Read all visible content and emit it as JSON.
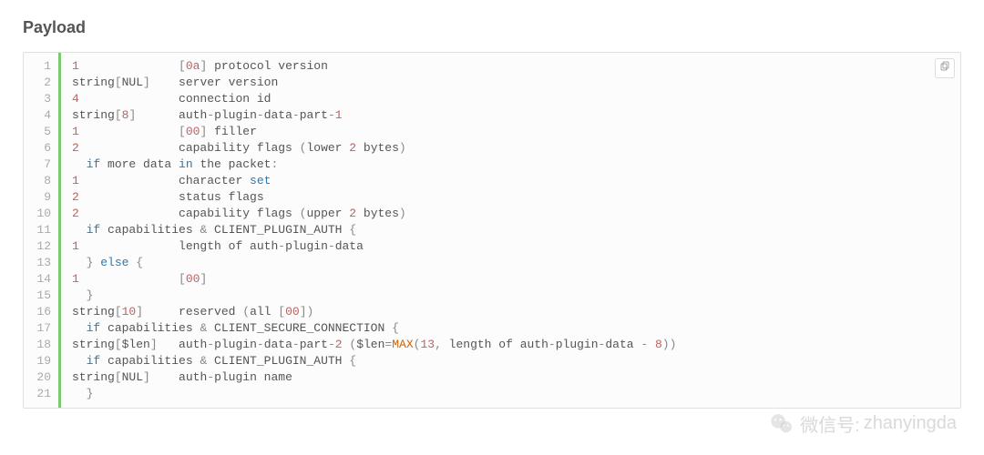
{
  "heading": "Payload",
  "watermark": {
    "label": "微信号:",
    "id": "zhanyingda"
  },
  "code": {
    "line_count": 21,
    "lines": [
      {
        "tokens": [
          {
            "t": "1",
            "c": "n"
          },
          {
            "t": "              ",
            "c": ""
          },
          {
            "t": "[",
            "c": "p"
          },
          {
            "t": "0a",
            "c": "n"
          },
          {
            "t": "]",
            "c": "p"
          },
          {
            "t": " protocol version",
            "c": ""
          }
        ]
      },
      {
        "tokens": [
          {
            "t": "string",
            "c": ""
          },
          {
            "t": "[",
            "c": "p"
          },
          {
            "t": "NUL",
            "c": ""
          },
          {
            "t": "]",
            "c": "p"
          },
          {
            "t": "    server version",
            "c": ""
          }
        ]
      },
      {
        "tokens": [
          {
            "t": "4",
            "c": "n"
          },
          {
            "t": "              connection id",
            "c": ""
          }
        ]
      },
      {
        "tokens": [
          {
            "t": "string",
            "c": ""
          },
          {
            "t": "[",
            "c": "p"
          },
          {
            "t": "8",
            "c": "n"
          },
          {
            "t": "]",
            "c": "p"
          },
          {
            "t": "      auth",
            "c": ""
          },
          {
            "t": "-",
            "c": "o"
          },
          {
            "t": "plugin",
            "c": ""
          },
          {
            "t": "-",
            "c": "o"
          },
          {
            "t": "data",
            "c": ""
          },
          {
            "t": "-",
            "c": "o"
          },
          {
            "t": "part",
            "c": ""
          },
          {
            "t": "-",
            "c": "o"
          },
          {
            "t": "1",
            "c": "n"
          }
        ]
      },
      {
        "tokens": [
          {
            "t": "1",
            "c": "n"
          },
          {
            "t": "              ",
            "c": ""
          },
          {
            "t": "[",
            "c": "p"
          },
          {
            "t": "00",
            "c": "n"
          },
          {
            "t": "]",
            "c": "p"
          },
          {
            "t": " filler",
            "c": ""
          }
        ]
      },
      {
        "tokens": [
          {
            "t": "2",
            "c": "n"
          },
          {
            "t": "              capability flags ",
            "c": ""
          },
          {
            "t": "(",
            "c": "p"
          },
          {
            "t": "lower ",
            "c": ""
          },
          {
            "t": "2",
            "c": "n"
          },
          {
            "t": " bytes",
            "c": ""
          },
          {
            "t": ")",
            "c": "p"
          }
        ]
      },
      {
        "tokens": [
          {
            "t": "  ",
            "c": ""
          },
          {
            "t": "if",
            "c": "kw"
          },
          {
            "t": " more data ",
            "c": ""
          },
          {
            "t": "in",
            "c": "kw"
          },
          {
            "t": " the packet",
            "c": ""
          },
          {
            "t": ":",
            "c": "p"
          }
        ]
      },
      {
        "tokens": [
          {
            "t": "1",
            "c": "n"
          },
          {
            "t": "              character ",
            "c": ""
          },
          {
            "t": "set",
            "c": "kw"
          }
        ]
      },
      {
        "tokens": [
          {
            "t": "2",
            "c": "n"
          },
          {
            "t": "              status flags",
            "c": ""
          }
        ]
      },
      {
        "tokens": [
          {
            "t": "2",
            "c": "n"
          },
          {
            "t": "              capability flags ",
            "c": ""
          },
          {
            "t": "(",
            "c": "p"
          },
          {
            "t": "upper ",
            "c": ""
          },
          {
            "t": "2",
            "c": "n"
          },
          {
            "t": " bytes",
            "c": ""
          },
          {
            "t": ")",
            "c": "p"
          }
        ]
      },
      {
        "tokens": [
          {
            "t": "  ",
            "c": ""
          },
          {
            "t": "if",
            "c": "kw"
          },
          {
            "t": " capabilities ",
            "c": ""
          },
          {
            "t": "&",
            "c": "o"
          },
          {
            "t": " CLIENT_PLUGIN_AUTH ",
            "c": ""
          },
          {
            "t": "{",
            "c": "p"
          }
        ]
      },
      {
        "tokens": [
          {
            "t": "1",
            "c": "n"
          },
          {
            "t": "              length of auth",
            "c": ""
          },
          {
            "t": "-",
            "c": "o"
          },
          {
            "t": "plugin",
            "c": ""
          },
          {
            "t": "-",
            "c": "o"
          },
          {
            "t": "data",
            "c": ""
          }
        ]
      },
      {
        "tokens": [
          {
            "t": "  ",
            "c": ""
          },
          {
            "t": "}",
            "c": "p"
          },
          {
            "t": " ",
            "c": ""
          },
          {
            "t": "else",
            "c": "kw"
          },
          {
            "t": " ",
            "c": ""
          },
          {
            "t": "{",
            "c": "p"
          }
        ]
      },
      {
        "tokens": [
          {
            "t": "1",
            "c": "n"
          },
          {
            "t": "              ",
            "c": ""
          },
          {
            "t": "[",
            "c": "p"
          },
          {
            "t": "00",
            "c": "n"
          },
          {
            "t": "]",
            "c": "p"
          }
        ]
      },
      {
        "tokens": [
          {
            "t": "  ",
            "c": ""
          },
          {
            "t": "}",
            "c": "p"
          }
        ]
      },
      {
        "tokens": [
          {
            "t": "string",
            "c": ""
          },
          {
            "t": "[",
            "c": "p"
          },
          {
            "t": "10",
            "c": "n"
          },
          {
            "t": "]",
            "c": "p"
          },
          {
            "t": "     reserved ",
            "c": ""
          },
          {
            "t": "(",
            "c": "p"
          },
          {
            "t": "all ",
            "c": ""
          },
          {
            "t": "[",
            "c": "p"
          },
          {
            "t": "00",
            "c": "n"
          },
          {
            "t": "]",
            "c": "p"
          },
          {
            "t": ")",
            "c": "p"
          }
        ]
      },
      {
        "tokens": [
          {
            "t": "  ",
            "c": ""
          },
          {
            "t": "if",
            "c": "kw"
          },
          {
            "t": " capabilities ",
            "c": ""
          },
          {
            "t": "&",
            "c": "o"
          },
          {
            "t": " CLIENT_SECURE_CONNECTION ",
            "c": ""
          },
          {
            "t": "{",
            "c": "p"
          }
        ]
      },
      {
        "tokens": [
          {
            "t": "string",
            "c": ""
          },
          {
            "t": "[",
            "c": "p"
          },
          {
            "t": "$len",
            "c": ""
          },
          {
            "t": "]",
            "c": "p"
          },
          {
            "t": "   auth",
            "c": ""
          },
          {
            "t": "-",
            "c": "o"
          },
          {
            "t": "plugin",
            "c": ""
          },
          {
            "t": "-",
            "c": "o"
          },
          {
            "t": "data",
            "c": ""
          },
          {
            "t": "-",
            "c": "o"
          },
          {
            "t": "part",
            "c": ""
          },
          {
            "t": "-",
            "c": "o"
          },
          {
            "t": "2",
            "c": "n"
          },
          {
            "t": " ",
            "c": ""
          },
          {
            "t": "(",
            "c": "p"
          },
          {
            "t": "$len",
            "c": ""
          },
          {
            "t": "=",
            "c": "o"
          },
          {
            "t": "MAX",
            "c": "fn"
          },
          {
            "t": "(",
            "c": "p"
          },
          {
            "t": "13",
            "c": "n"
          },
          {
            "t": ",",
            "c": "p"
          },
          {
            "t": " length of auth",
            "c": ""
          },
          {
            "t": "-",
            "c": "o"
          },
          {
            "t": "plugin",
            "c": ""
          },
          {
            "t": "-",
            "c": "o"
          },
          {
            "t": "data ",
            "c": ""
          },
          {
            "t": "-",
            "c": "o"
          },
          {
            "t": " ",
            "c": ""
          },
          {
            "t": "8",
            "c": "n"
          },
          {
            "t": ")",
            "c": "p"
          },
          {
            "t": ")",
            "c": "p"
          }
        ]
      },
      {
        "tokens": [
          {
            "t": "  ",
            "c": ""
          },
          {
            "t": "if",
            "c": "kw"
          },
          {
            "t": " capabilities ",
            "c": ""
          },
          {
            "t": "&",
            "c": "o"
          },
          {
            "t": " CLIENT_PLUGIN_AUTH ",
            "c": ""
          },
          {
            "t": "{",
            "c": "p"
          }
        ]
      },
      {
        "tokens": [
          {
            "t": "string",
            "c": ""
          },
          {
            "t": "[",
            "c": "p"
          },
          {
            "t": "NUL",
            "c": ""
          },
          {
            "t": "]",
            "c": "p"
          },
          {
            "t": "    auth",
            "c": ""
          },
          {
            "t": "-",
            "c": "o"
          },
          {
            "t": "plugin name",
            "c": ""
          }
        ]
      },
      {
        "tokens": [
          {
            "t": "  ",
            "c": ""
          },
          {
            "t": "}",
            "c": "p"
          }
        ]
      }
    ]
  }
}
